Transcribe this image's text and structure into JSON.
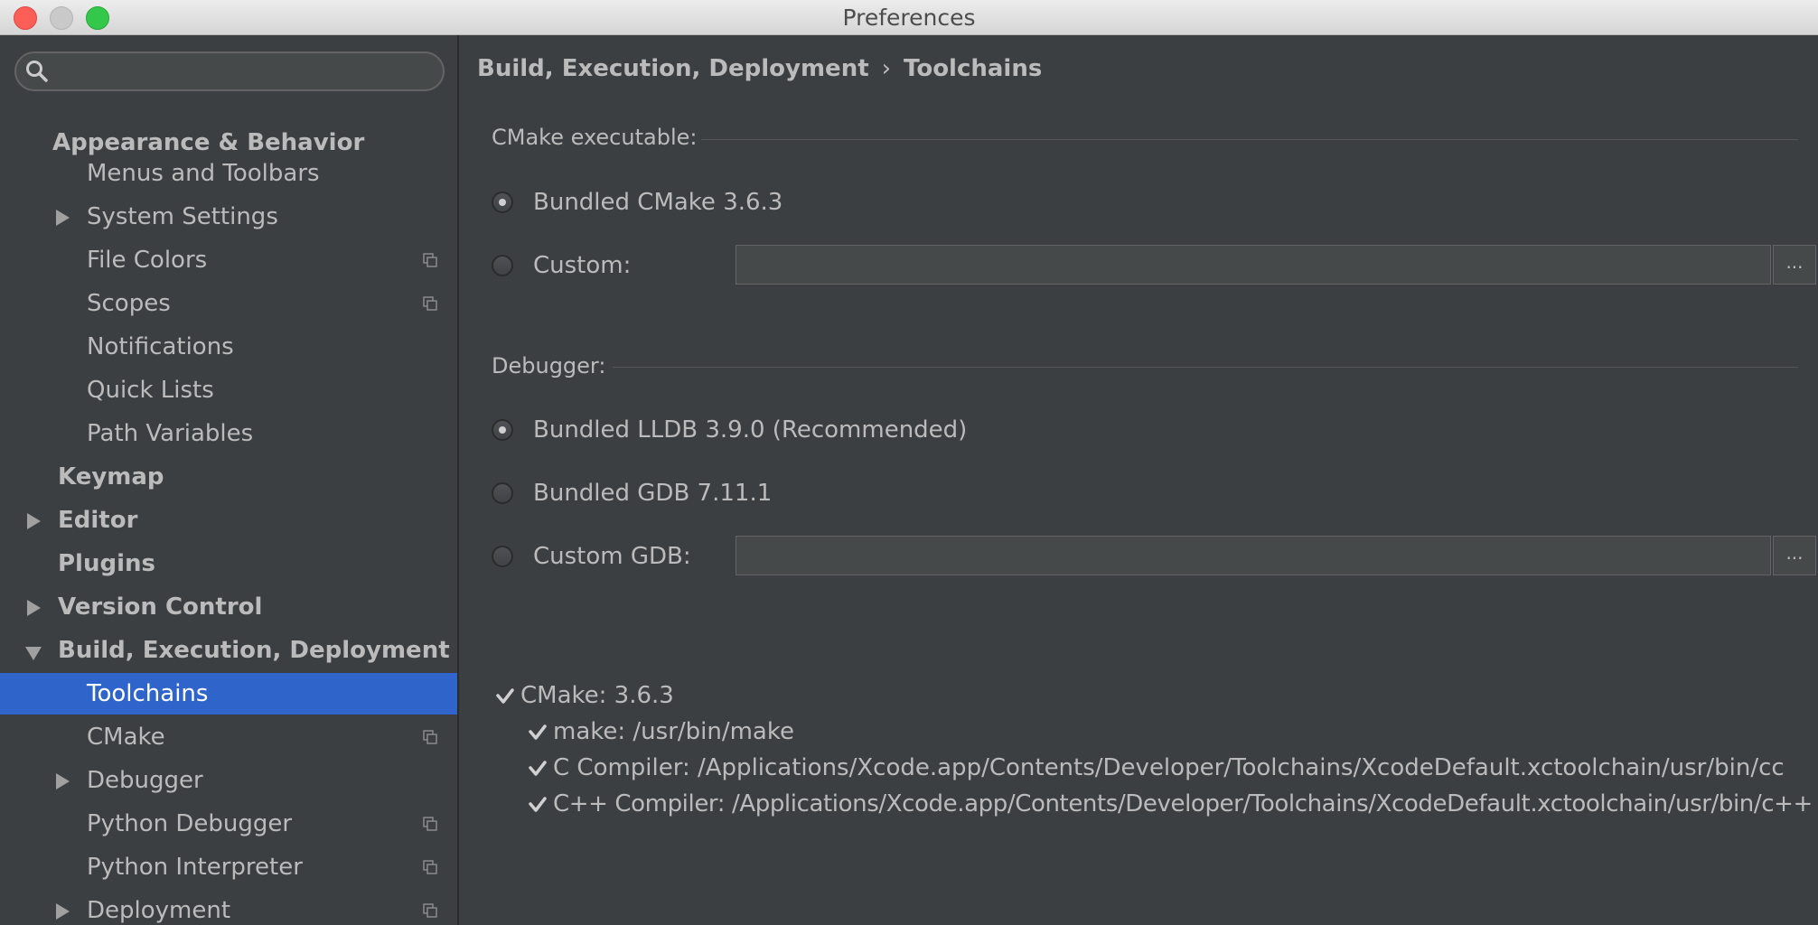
{
  "window": {
    "title": "Preferences"
  },
  "search": {
    "placeholder": ""
  },
  "sidebar": {
    "items": [
      {
        "label": "Appearance & Behavior",
        "bold": true,
        "arrow": "none"
      },
      {
        "label": "Menus and Toolbars",
        "arrow": "none"
      },
      {
        "label": "System Settings",
        "arrow": "right"
      },
      {
        "label": "File Colors",
        "arrow": "none",
        "project_icon": true
      },
      {
        "label": "Scopes",
        "arrow": "none",
        "project_icon": true
      },
      {
        "label": "Notifications",
        "arrow": "none"
      },
      {
        "label": "Quick Lists",
        "arrow": "none"
      },
      {
        "label": "Path Variables",
        "arrow": "none"
      },
      {
        "label": "Keymap",
        "bold": true,
        "arrow": "none"
      },
      {
        "label": "Editor",
        "bold": true,
        "arrow": "right"
      },
      {
        "label": "Plugins",
        "bold": true,
        "arrow": "none"
      },
      {
        "label": "Version Control",
        "bold": true,
        "arrow": "right"
      },
      {
        "label": "Build, Execution, Deployment",
        "bold": true,
        "arrow": "down"
      },
      {
        "label": "Toolchains",
        "arrow": "none",
        "selected": true
      },
      {
        "label": "CMake",
        "arrow": "none",
        "project_icon": true
      },
      {
        "label": "Debugger",
        "arrow": "right"
      },
      {
        "label": "Python Debugger",
        "arrow": "none",
        "project_icon": true
      },
      {
        "label": "Python Interpreter",
        "arrow": "none",
        "project_icon": true
      },
      {
        "label": "Deployment",
        "arrow": "right",
        "project_icon": true
      }
    ]
  },
  "breadcrumb": {
    "parent": "Build, Execution, Deployment",
    "separator": "›",
    "current": "Toolchains"
  },
  "cmake": {
    "title": "CMake executable:",
    "bundled_label": "Bundled CMake 3.6.3",
    "custom_label": "Custom:",
    "custom_value": "",
    "selected": "bundled"
  },
  "debugger": {
    "title": "Debugger:",
    "lldb_label": "Bundled LLDB 3.9.0 (Recommended)",
    "gdb_label": "Bundled GDB 7.11.1",
    "custom_label": "Custom GDB:",
    "custom_value": "",
    "selected": "lldb"
  },
  "browse_label": "...",
  "checks": {
    "cmake": "CMake: 3.6.3",
    "make": "make: /usr/bin/make",
    "c_compiler": "C Compiler: /Applications/Xcode.app/Contents/Developer/Toolchains/XcodeDefault.xctoolchain/usr/bin/cc",
    "cpp_compiler": "C++ Compiler: /Applications/Xcode.app/Contents/Developer/Toolchains/XcodeDefault.xctoolchain/usr/bin/c++"
  },
  "colors": {
    "accent": "#2f65ca",
    "background": "#3c3f41",
    "text": "#bbbbbb"
  },
  "icons": {
    "search": "search-icon",
    "check": "check-icon",
    "project": "project-level-icon"
  }
}
